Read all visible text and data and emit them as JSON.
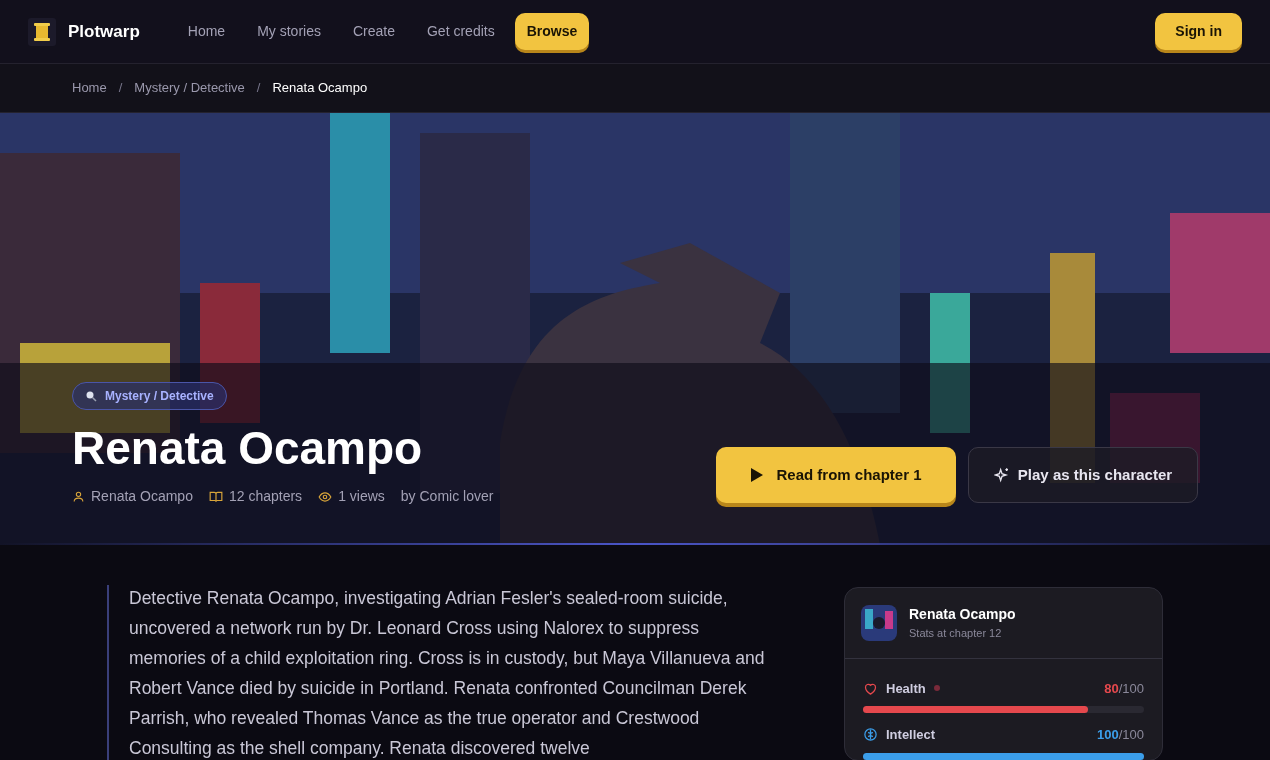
{
  "brand": {
    "name": "Plotwarp"
  },
  "nav": [
    {
      "label": "Home",
      "selected": false
    },
    {
      "label": "My stories",
      "selected": false
    },
    {
      "label": "Create",
      "selected": false
    },
    {
      "label": "Get credits",
      "selected": false
    },
    {
      "label": "Browse",
      "selected": true
    }
  ],
  "sign_in": "Sign in",
  "breadcrumb": {
    "separator": "/",
    "items": [
      "Home",
      "Mystery / Detective",
      "Renata Ocampo"
    ]
  },
  "hero": {
    "kind": "picture",
    "genre": "Mystery / Detective",
    "title": "Renata Ocampo",
    "meta": [
      {
        "kind": "person",
        "text": "Renata Ocampo"
      },
      {
        "kind": "book",
        "text": "12 chapters"
      },
      {
        "kind": "eye",
        "text": "1 views"
      },
      {
        "kind": "plain",
        "text": "by Comic lover"
      }
    ],
    "primary_button": "Read from chapter 1",
    "secondary_button": "Play as this character"
  },
  "summary": "Detective Renata Ocampo, investigating Adrian Fesler's sealed-room suicide, uncovered a network run by Dr. Leonard Cross using Nalorex to suppress memories of a child exploitation ring. Cross is in custody, but Maya Villanueva and Robert Vance died by suicide in Portland. Renata confronted Councilman Derek Parrish, who revealed Thomas Vance as the true operator and Crestwood Consulting as the shell company. Renata discovered twelve",
  "stats_card": {
    "name": "Renata Ocampo",
    "subtitle": "Stats at chapter 12",
    "stats": [
      {
        "kind": "heart",
        "label": "Health",
        "value": "80",
        "max": "/100",
        "level": 0.8,
        "color": "#e5484d",
        "flag": true
      },
      {
        "kind": "brain",
        "label": "Intellect",
        "value": "100",
        "max": "/100",
        "level": 1.0,
        "color": "#3b9eea",
        "flag": false
      }
    ]
  }
}
